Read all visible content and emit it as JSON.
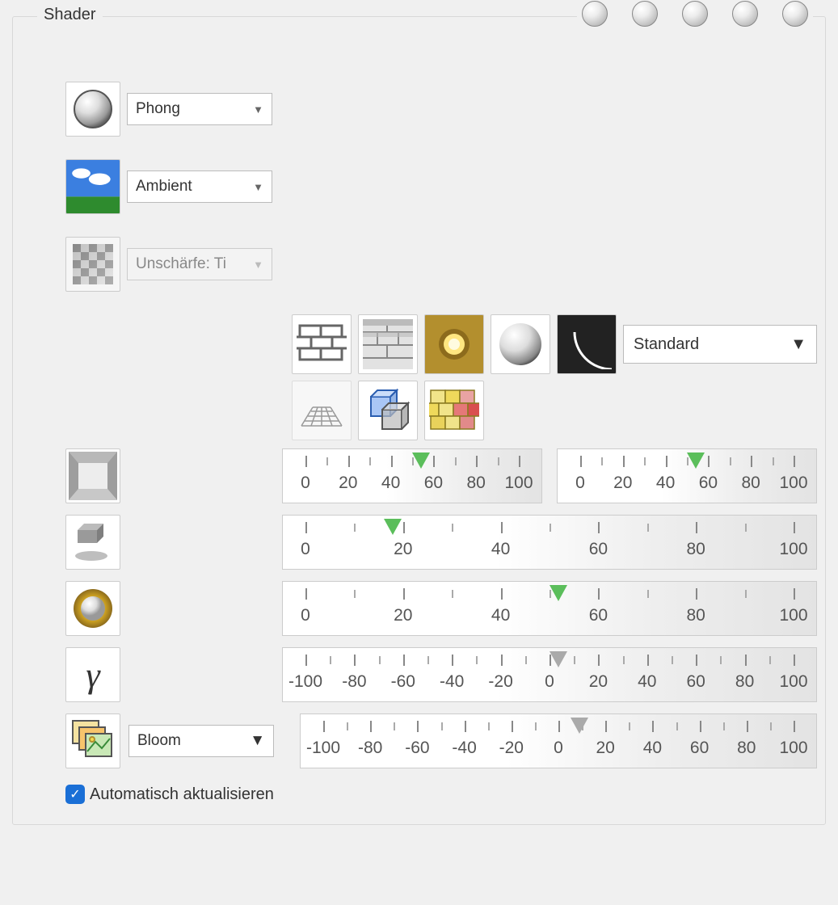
{
  "panel": {
    "title": "Shader"
  },
  "presets": {
    "count": 5
  },
  "shading": {
    "label": "Phong"
  },
  "environment": {
    "label": "Ambient"
  },
  "blur": {
    "label": "Unschärfe: Ti"
  },
  "projection": {
    "label": "Standard"
  },
  "sliders": {
    "ambient_a": {
      "ticks": [
        0,
        20,
        40,
        60,
        80,
        100
      ],
      "value": 50,
      "color": "green"
    },
    "ambient_b": {
      "ticks": [
        0,
        20,
        40,
        60,
        80,
        100
      ],
      "value": 50,
      "color": "green"
    },
    "softshadow": {
      "ticks": [
        0,
        20,
        40,
        60,
        80,
        100
      ],
      "value": 16,
      "color": "green"
    },
    "luster": {
      "ticks": [
        0,
        20,
        40,
        60,
        80,
        100
      ],
      "value": 50,
      "color": "green"
    },
    "gamma": {
      "ticks": [
        -100,
        -80,
        -60,
        -40,
        -20,
        0,
        20,
        40,
        60,
        80,
        100
      ],
      "value": 0,
      "color": "gray"
    },
    "bloom": {
      "ticks": [
        -100,
        -80,
        -60,
        -40,
        -20,
        0,
        20,
        40,
        60,
        80,
        100
      ],
      "value": 5,
      "color": "gray"
    }
  },
  "post_effect": {
    "label": "Bloom"
  },
  "auto_update": {
    "label": "Automatisch aktualisieren",
    "checked": true
  }
}
